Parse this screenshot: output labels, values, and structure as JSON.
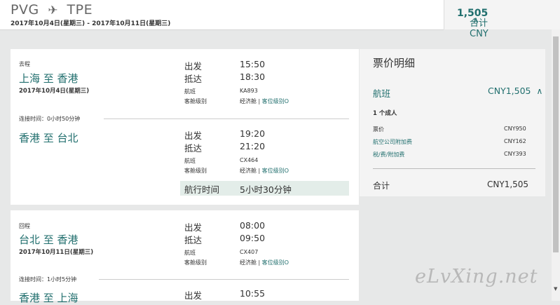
{
  "header": {
    "origin": "PVG",
    "plane_icon": "✈",
    "destination": "TPE",
    "dates": "2017年10月4日(星期三) - 2017年10月11日(星期三)"
  },
  "total_bar": {
    "label": "合计 CNY",
    "amount": "1,505",
    "chevron": "∧"
  },
  "outbound": {
    "direction": "去程",
    "segment1": {
      "route": "上海 至 香港",
      "date": "2017年10月4日(星期三)",
      "depart_label": "出发",
      "depart_time": "15:50",
      "arrive_label": "抵达",
      "arrive_time": "18:30",
      "flight_label": "航班",
      "flight_no": "KA893",
      "cabin_label": "客舱级别",
      "cabin": "经济舱 | ",
      "fare_class": "客位级别O"
    },
    "connection": "连接时间：0小时50分钟",
    "segment2": {
      "route": "香港 至 台北",
      "depart_label": "出发",
      "depart_time": "19:20",
      "arrive_label": "抵达",
      "arrive_time": "21:20",
      "flight_label": "航班",
      "flight_no": "CX464",
      "cabin_label": "客舱级别",
      "cabin": "经济舱 | ",
      "fare_class": "客位级别O"
    },
    "duration_label": "航行时间",
    "duration": "5小时30分钟"
  },
  "return": {
    "direction": "回程",
    "segment1": {
      "route": "台北 至 香港",
      "date": "2017年10月11日(星期三)",
      "depart_label": "出发",
      "depart_time": "08:00",
      "arrive_label": "抵达",
      "arrive_time": "09:50",
      "flight_label": "航班",
      "flight_no": "CX407",
      "cabin_label": "客舱级别",
      "cabin": "经济舱 | ",
      "fare_class": "客位级别O"
    },
    "connection": "连接时间：1小时5分钟",
    "segment2_partial": {
      "route": "香港 至 上海",
      "depart_label": "出发",
      "depart_time": "10:55"
    }
  },
  "fare_panel": {
    "title": "票价明细",
    "flight_label": "航班",
    "flight_total": "CNY1,505",
    "chevron": "∧",
    "passengers": "1 个成人",
    "rows": [
      {
        "label": "票价",
        "amount": "CNY950"
      },
      {
        "label": "航空公司附加费",
        "amount": "CNY162"
      },
      {
        "label": "税/费/附加费",
        "amount": "CNY393"
      }
    ],
    "total_label": "合计",
    "total": "CNY1,505"
  },
  "watermark": "eLvXing.net",
  "colors": {
    "accent": "#216f6e",
    "background": "#e7e8e8",
    "highlight": "#e3ede9"
  }
}
